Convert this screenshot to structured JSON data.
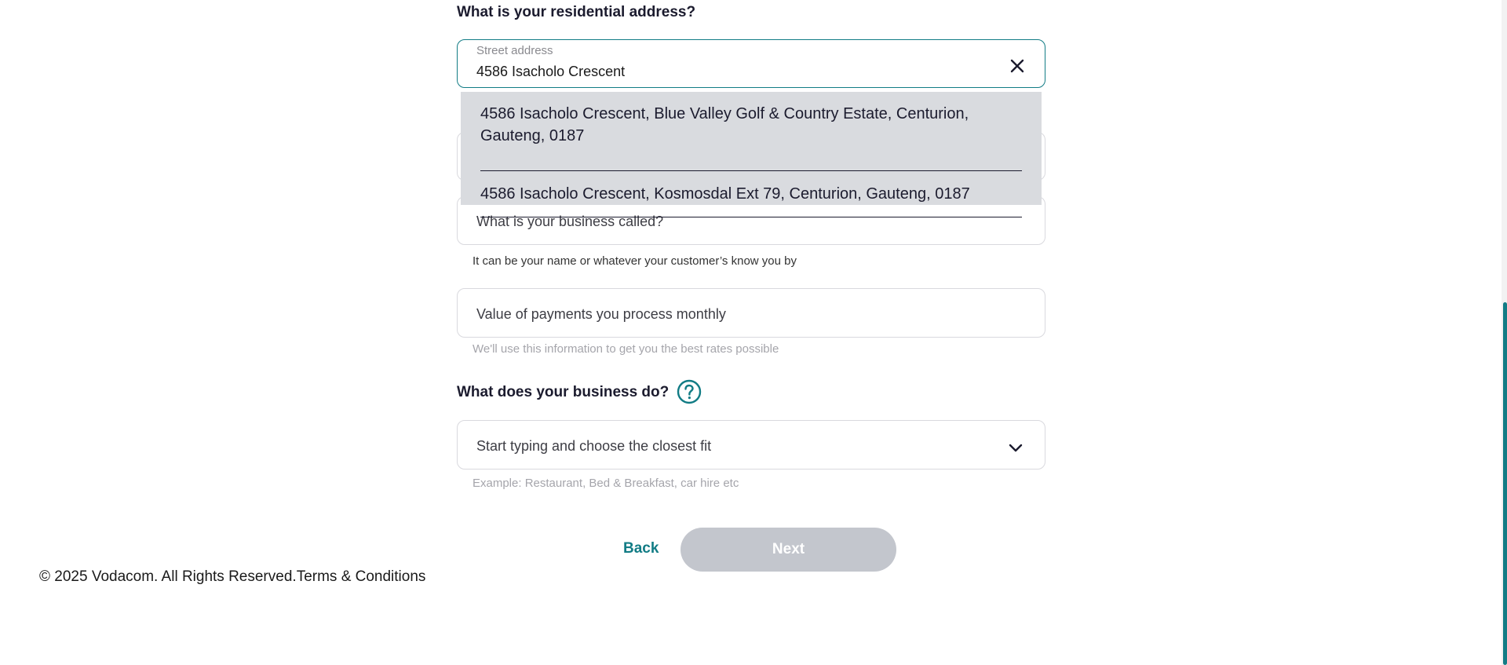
{
  "address_question": "What is your residential address?",
  "street_field": {
    "label": "Street address",
    "value": "4586 Isacholo Crescent"
  },
  "suggestions": [
    "4586 Isacholo Crescent, Blue Valley Golf & Country Estate, Centurion, Gauteng, 0187",
    "4586 Isacholo Crescent, Kosmosdal Ext 79, Centurion, Gauteng, 0187"
  ],
  "business_name_field": {
    "placeholder": "What is your business called?",
    "helper": "It can be your name or whatever your customer’s know you by"
  },
  "payments_field": {
    "placeholder": "Value of payments you process monthly",
    "helper": "We'll use this information to get you the best rates possible"
  },
  "business_type_question": "What does your business do?",
  "business_type_field": {
    "placeholder": "Start typing and choose the closest fit",
    "helper": "Example: Restaurant, Bed & Breakfast, car hire etc"
  },
  "actions": {
    "back_label": "Back",
    "next_label": "Next"
  },
  "footer": {
    "copyright": "© 2025 Vodacom. All Rights Reserved.",
    "terms_label": "Terms & Conditions"
  },
  "icons": {
    "clear": "close-icon",
    "help": "question-circle-icon",
    "chevron": "chevron-down-icon"
  },
  "colors": {
    "accent": "#127c85",
    "disabled_button": "#c3c6cd",
    "dropdown_bg": "#d9dbdf"
  }
}
